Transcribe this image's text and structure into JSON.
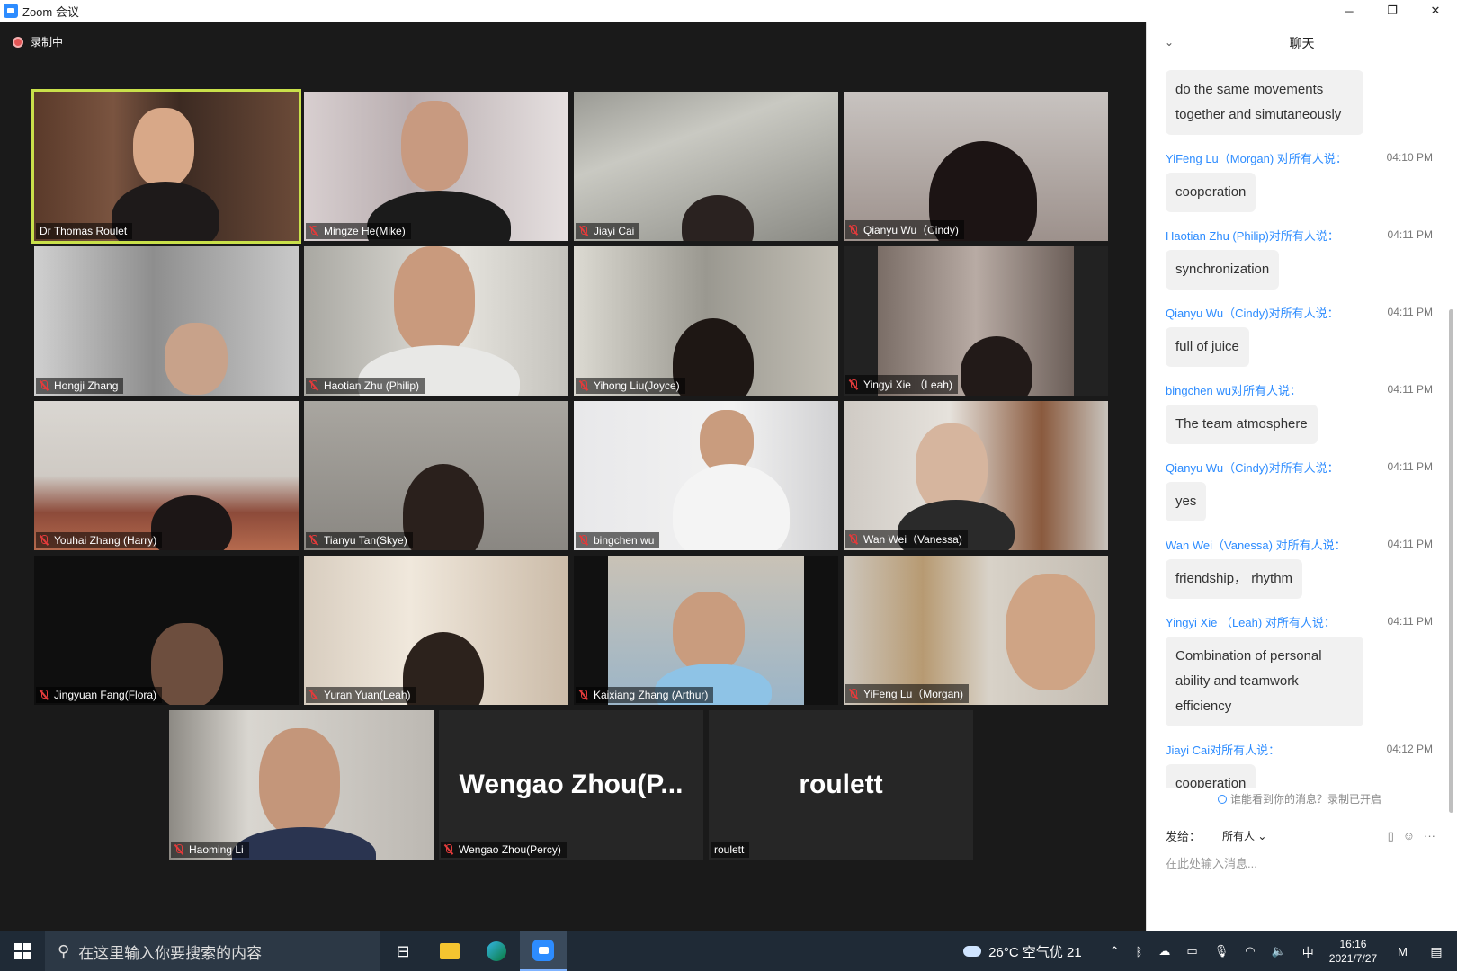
{
  "window": {
    "title": "Zoom 会议",
    "controls": [
      "─",
      "❐",
      "✕"
    ]
  },
  "recording": {
    "label": "录制中"
  },
  "participants": [
    {
      "name": "Dr Thomas Roulet",
      "muted": false,
      "active": true
    },
    {
      "name": "Mingze He(Mike)",
      "muted": true
    },
    {
      "name": "Jiayi Cai",
      "muted": true
    },
    {
      "name": "Qianyu Wu（Cindy)",
      "muted": true
    },
    {
      "name": "Hongji Zhang",
      "muted": true
    },
    {
      "name": "Haotian Zhu (Philip)",
      "muted": true
    },
    {
      "name": "Yihong Liu(Joyce)",
      "muted": true
    },
    {
      "name": "Yingyi Xie （Leah)",
      "muted": true
    },
    {
      "name": "Youhai Zhang (Harry)",
      "muted": true
    },
    {
      "name": "Tianyu Tan(Skye)",
      "muted": true
    },
    {
      "name": "bingchen wu",
      "muted": true
    },
    {
      "name": "Wan Wei（Vanessa)",
      "muted": true
    },
    {
      "name": "Jingyuan Fang(Flora)",
      "muted": true
    },
    {
      "name": "Yuran Yuan(Leah)",
      "muted": true
    },
    {
      "name": "Kaixiang Zhang (Arthur)",
      "muted": true
    },
    {
      "name": "YiFeng Lu（Morgan)",
      "muted": true
    },
    {
      "name": "Haoming Li",
      "muted": true
    },
    {
      "name": "Wengao Zhou(Percy)",
      "muted": true,
      "display_name": "Wengao  Zhou(P..."
    },
    {
      "name": "roulett",
      "muted": false,
      "display_name": "roulett"
    }
  ],
  "chat": {
    "title": "聊天",
    "messages": [
      {
        "sender": "",
        "to": "",
        "time": "",
        "text": "do the same movements together and simutaneously"
      },
      {
        "sender": "YiFeng Lu（Morgan) ",
        "to": "对所有人说：",
        "time": "04:10 PM",
        "text": "cooperation"
      },
      {
        "sender": "Haotian Zhu (Philip)",
        "to": "对所有人说：",
        "time": "04:11 PM",
        "text": "synchronization"
      },
      {
        "sender": "Qianyu Wu（Cindy)",
        "to": "对所有人说：",
        "time": "04:11 PM",
        "text": "full of juice"
      },
      {
        "sender": "bingchen wu",
        "to": "对所有人说：",
        "time": "04:11 PM",
        "text": "The team atmosphere"
      },
      {
        "sender": "Qianyu Wu（Cindy)",
        "to": "对所有人说：",
        "time": "04:11 PM",
        "text": "yes"
      },
      {
        "sender": "Wan Wei（Vanessa) ",
        "to": "对所有人说：",
        "time": "04:11 PM",
        "text": "friendship， rhythm"
      },
      {
        "sender": "Yingyi Xie （Leah) ",
        "to": "对所有人说：",
        "time": "04:11 PM",
        "text": "Combination of personal ability and teamwork efficiency"
      },
      {
        "sender": "Jiayi Cai",
        "to": "对所有人说：",
        "time": "04:12 PM",
        "text": "cooperation"
      }
    ],
    "notice": "谁能看到你的消息？录制已开启",
    "send_label": "发给：",
    "send_to": "所有人 ⌄",
    "input_placeholder": "在此处输入消息..."
  },
  "taskbar": {
    "search_placeholder": "在这里输入你要搜索的内容",
    "weather": "26°C 空气优 21",
    "ime": "中",
    "time": "16:16",
    "date": "2021/7/27"
  }
}
